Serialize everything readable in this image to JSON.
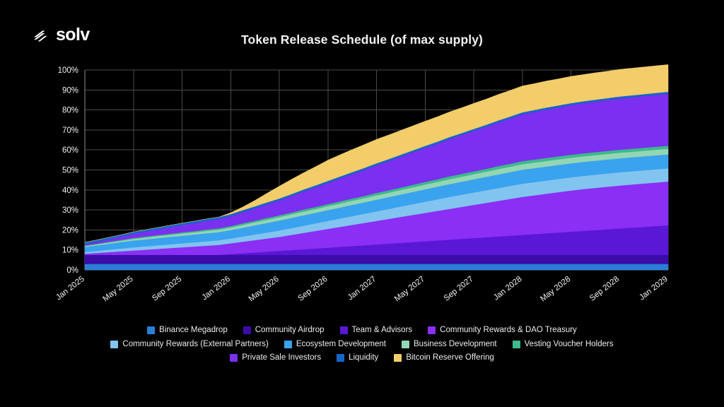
{
  "brand": {
    "name": "solv",
    "logo_icon": "solv-bars-icon"
  },
  "header": {
    "title": "Token Release Schedule (of max supply)"
  },
  "legend": {
    "rows": [
      [
        {
          "label": "Binance Megadrop",
          "color": "#2a7fd4"
        },
        {
          "label": "Community Airdrop",
          "color": "#3a0ca8"
        },
        {
          "label": "Team & Advisors",
          "color": "#5a17d6"
        },
        {
          "label": "Community Rewards & DAO Treasury",
          "color": "#8b2ff5"
        }
      ],
      [
        {
          "label": "Community Rewards (External Partners)",
          "color": "#82c4f0"
        },
        {
          "label": "Ecosystem Development",
          "color": "#3aa3ef"
        },
        {
          "label": "Business Development",
          "color": "#93d6b4"
        },
        {
          "label": "Vesting Voucher Holders",
          "color": "#3cba8c"
        }
      ],
      [
        {
          "label": "Private Sale Investors",
          "color": "#7b2ff0"
        },
        {
          "label": "Liquidity",
          "color": "#1565c9"
        },
        {
          "label": "Bitcoin Reserve Offering",
          "color": "#f2cd6a"
        }
      ]
    ]
  },
  "chart_data": {
    "type": "area",
    "stacked": true,
    "title": "Token Release Schedule (of max supply)",
    "xlabel": "",
    "ylabel": "",
    "ylim": [
      0,
      100
    ],
    "ytick_labels": [
      "0%",
      "10%",
      "20%",
      "30%",
      "40%",
      "50%",
      "60%",
      "70%",
      "80%",
      "90%",
      "100%"
    ],
    "ytick_values": [
      0,
      10,
      20,
      30,
      40,
      50,
      60,
      70,
      80,
      90,
      100
    ],
    "grid": true,
    "legend_position": "bottom",
    "x_tick_labels": [
      "Jan 2025",
      "May 2025",
      "Sep 2025",
      "Jan 2026",
      "May 2026",
      "Sep 2026",
      "Jan 2027",
      "May 2027",
      "Sep 2027",
      "Jan 2028",
      "May 2028",
      "Sep 2028",
      "Jan 2029"
    ],
    "x": [
      "Jan 2025",
      "Feb 2025",
      "Mar 2025",
      "Apr 2025",
      "May 2025",
      "Jun 2025",
      "Jul 2025",
      "Aug 2025",
      "Sep 2025",
      "Oct 2025",
      "Nov 2025",
      "Dec 2025",
      "Jan 2026",
      "Feb 2026",
      "Mar 2026",
      "Apr 2026",
      "May 2026",
      "Jun 2026",
      "Jul 2026",
      "Aug 2026",
      "Sep 2026",
      "Oct 2026",
      "Nov 2026",
      "Dec 2026",
      "Jan 2027",
      "Feb 2027",
      "Mar 2027",
      "Apr 2027",
      "May 2027",
      "Jun 2027",
      "Jul 2027",
      "Aug 2027",
      "Sep 2027",
      "Oct 2027",
      "Nov 2027",
      "Dec 2027",
      "Jan 2028",
      "Feb 2028",
      "Mar 2028",
      "Apr 2028",
      "May 2028",
      "Jun 2028",
      "Jul 2028",
      "Aug 2028",
      "Sep 2028",
      "Oct 2028",
      "Nov 2028",
      "Dec 2028",
      "Jan 2029"
    ],
    "series": [
      {
        "name": "Binance Megadrop",
        "color": "#2a7fd4",
        "values": [
          3.0,
          3.0,
          3.0,
          3.0,
          3.0,
          3.0,
          3.0,
          3.0,
          3.0,
          3.0,
          3.0,
          3.0,
          3.0,
          3.0,
          3.0,
          3.0,
          3.0,
          3.0,
          3.0,
          3.0,
          3.0,
          3.0,
          3.0,
          3.0,
          3.0,
          3.0,
          3.0,
          3.0,
          3.0,
          3.0,
          3.0,
          3.0,
          3.0,
          3.0,
          3.0,
          3.0,
          3.0,
          3.0,
          3.0,
          3.0,
          3.0,
          3.0,
          3.0,
          3.0,
          3.0,
          3.0,
          3.0,
          3.0,
          3.0
        ]
      },
      {
        "name": "Community Airdrop",
        "color": "#3a0ca8",
        "values": [
          4.5,
          4.5,
          4.5,
          4.5,
          4.5,
          4.5,
          4.5,
          4.5,
          4.5,
          4.5,
          4.5,
          4.5,
          4.5,
          4.5,
          4.5,
          4.5,
          4.5,
          4.5,
          4.5,
          4.5,
          4.5,
          4.5,
          4.5,
          4.5,
          4.5,
          4.5,
          4.5,
          4.5,
          4.5,
          4.5,
          4.5,
          4.5,
          4.5,
          4.5,
          4.5,
          4.5,
          4.5,
          4.5,
          4.5,
          4.5,
          4.5,
          4.5,
          4.5,
          4.5,
          4.5,
          4.5,
          4.5,
          4.5,
          4.5
        ]
      },
      {
        "name": "Team & Advisors",
        "color": "#5a17d6",
        "values": [
          0.0,
          0.0,
          0.0,
          0.0,
          0.0,
          0.0,
          0.0,
          0.0,
          0.0,
          0.0,
          0.0,
          0.0,
          0.4,
          0.8,
          1.2,
          1.6,
          2.0,
          2.4,
          2.8,
          3.2,
          3.6,
          4.0,
          4.4,
          4.8,
          5.2,
          5.6,
          6.0,
          6.4,
          6.8,
          7.2,
          7.6,
          8.0,
          8.4,
          8.8,
          9.2,
          9.6,
          10.0,
          10.4,
          10.8,
          11.2,
          11.6,
          12.0,
          12.4,
          12.8,
          13.2,
          13.6,
          14.0,
          14.4,
          14.8
        ]
      },
      {
        "name": "Community Rewards & DAO Treasury",
        "color": "#8b2ff5",
        "values": [
          0.6,
          1.0,
          1.4,
          1.8,
          2.2,
          2.6,
          3.0,
          3.4,
          3.8,
          4.2,
          4.6,
          5.0,
          5.4,
          5.8,
          6.2,
          6.6,
          7.0,
          7.6,
          8.2,
          8.8,
          9.4,
          10.0,
          10.6,
          11.2,
          11.8,
          12.4,
          13.0,
          13.6,
          14.2,
          14.8,
          15.4,
          16.0,
          16.6,
          17.2,
          17.8,
          18.4,
          19.0,
          19.4,
          19.8,
          20.2,
          20.6,
          20.9,
          21.1,
          21.3,
          21.5,
          21.6,
          21.7,
          21.8,
          21.9
        ]
      },
      {
        "name": "Community Rewards (External Partners)",
        "color": "#82c4f0",
        "values": [
          0.8,
          1.0,
          1.2,
          1.4,
          1.6,
          1.7,
          1.8,
          1.9,
          2.0,
          2.1,
          2.2,
          2.3,
          2.4,
          2.6,
          2.8,
          3.0,
          3.2,
          3.4,
          3.6,
          3.8,
          4.0,
          4.2,
          4.4,
          4.6,
          4.8,
          5.0,
          5.2,
          5.4,
          5.6,
          5.8,
          6.0,
          6.1,
          6.2,
          6.3,
          6.4,
          6.5,
          6.6,
          6.6,
          6.6,
          6.6,
          6.6,
          6.6,
          6.6,
          6.6,
          6.6,
          6.6,
          6.6,
          6.6,
          6.6
        ]
      },
      {
        "name": "Ecosystem Development",
        "color": "#3aa3ef",
        "values": [
          2.6,
          2.8,
          3.0,
          3.2,
          3.4,
          3.5,
          3.6,
          3.7,
          3.8,
          3.9,
          4.0,
          4.1,
          4.2,
          4.4,
          4.6,
          4.8,
          5.0,
          5.1,
          5.2,
          5.3,
          5.4,
          5.5,
          5.6,
          5.7,
          5.8,
          5.9,
          6.0,
          6.1,
          6.2,
          6.3,
          6.4,
          6.5,
          6.6,
          6.7,
          6.8,
          6.9,
          7.0,
          7.0,
          7.0,
          7.0,
          7.0,
          7.0,
          7.0,
          7.0,
          7.0,
          7.0,
          7.0,
          7.0,
          7.0
        ]
      },
      {
        "name": "Business Development",
        "color": "#93d6b4",
        "values": [
          0.4,
          0.5,
          0.6,
          0.7,
          0.8,
          0.9,
          1.0,
          1.0,
          1.1,
          1.1,
          1.2,
          1.2,
          1.3,
          1.4,
          1.5,
          1.6,
          1.7,
          1.8,
          1.9,
          1.9,
          2.0,
          2.0,
          2.1,
          2.1,
          2.2,
          2.2,
          2.3,
          2.3,
          2.4,
          2.4,
          2.5,
          2.5,
          2.6,
          2.6,
          2.7,
          2.7,
          2.8,
          2.8,
          2.8,
          2.8,
          2.8,
          2.8,
          2.8,
          2.8,
          2.8,
          2.8,
          2.8,
          2.8,
          2.8
        ]
      },
      {
        "name": "Vesting Voucher Holders",
        "color": "#3cba8c",
        "values": [
          0.3,
          0.3,
          0.4,
          0.4,
          0.5,
          0.5,
          0.5,
          0.6,
          0.6,
          0.6,
          0.7,
          0.7,
          0.7,
          0.8,
          0.8,
          0.9,
          0.9,
          0.9,
          1.0,
          1.0,
          1.0,
          1.1,
          1.1,
          1.1,
          1.2,
          1.2,
          1.2,
          1.3,
          1.3,
          1.3,
          1.4,
          1.4,
          1.4,
          1.4,
          1.5,
          1.5,
          1.5,
          1.5,
          1.5,
          1.5,
          1.5,
          1.5,
          1.5,
          1.5,
          1.5,
          1.5,
          1.5,
          1.5,
          1.5
        ]
      },
      {
        "name": "Private Sale Investors",
        "color": "#7b2ff0",
        "values": [
          0.6,
          0.9,
          1.2,
          1.6,
          2.0,
          2.4,
          2.8,
          3.2,
          3.6,
          4.0,
          4.3,
          4.6,
          5.0,
          5.6,
          6.2,
          6.8,
          7.4,
          8.2,
          9.0,
          9.8,
          10.6,
          11.4,
          12.2,
          13.0,
          13.8,
          14.6,
          15.4,
          16.2,
          17.0,
          17.8,
          18.6,
          19.4,
          20.2,
          21.0,
          21.8,
          22.6,
          23.4,
          23.8,
          24.2,
          24.5,
          24.8,
          25.0,
          25.2,
          25.4,
          25.6,
          25.7,
          25.8,
          25.9,
          26.0
        ]
      },
      {
        "name": "Liquidity",
        "color": "#1565c9",
        "values": [
          1.0,
          1.0,
          1.0,
          1.0,
          1.0,
          1.0,
          1.0,
          1.0,
          1.0,
          1.0,
          1.0,
          1.0,
          1.0,
          1.0,
          1.0,
          1.0,
          1.0,
          1.0,
          1.0,
          1.0,
          1.0,
          1.0,
          1.0,
          1.0,
          1.0,
          1.0,
          1.0,
          1.0,
          1.0,
          1.0,
          1.0,
          1.0,
          1.0,
          1.0,
          1.0,
          1.0,
          1.0,
          1.0,
          1.0,
          1.0,
          1.0,
          1.0,
          1.0,
          1.0,
          1.0,
          1.0,
          1.0,
          1.0,
          1.0
        ]
      },
      {
        "name": "Bitcoin Reserve Offering",
        "color": "#f2cd6a",
        "values": [
          0.0,
          0.0,
          0.0,
          0.0,
          0.0,
          0.0,
          0.0,
          0.0,
          0.0,
          0.0,
          0.0,
          0.0,
          0.7,
          1.6,
          3.0,
          4.6,
          6.2,
          7.4,
          8.4,
          9.4,
          10.4,
          10.9,
          11.3,
          11.7,
          12.0,
          12.1,
          12.2,
          12.3,
          12.4,
          12.5,
          12.6,
          12.7,
          12.8,
          12.9,
          13.0,
          13.1,
          13.2,
          13.2,
          13.3,
          13.3,
          13.4,
          13.4,
          13.5,
          13.5,
          13.6,
          13.6,
          13.6,
          13.6,
          13.6
        ]
      }
    ]
  }
}
